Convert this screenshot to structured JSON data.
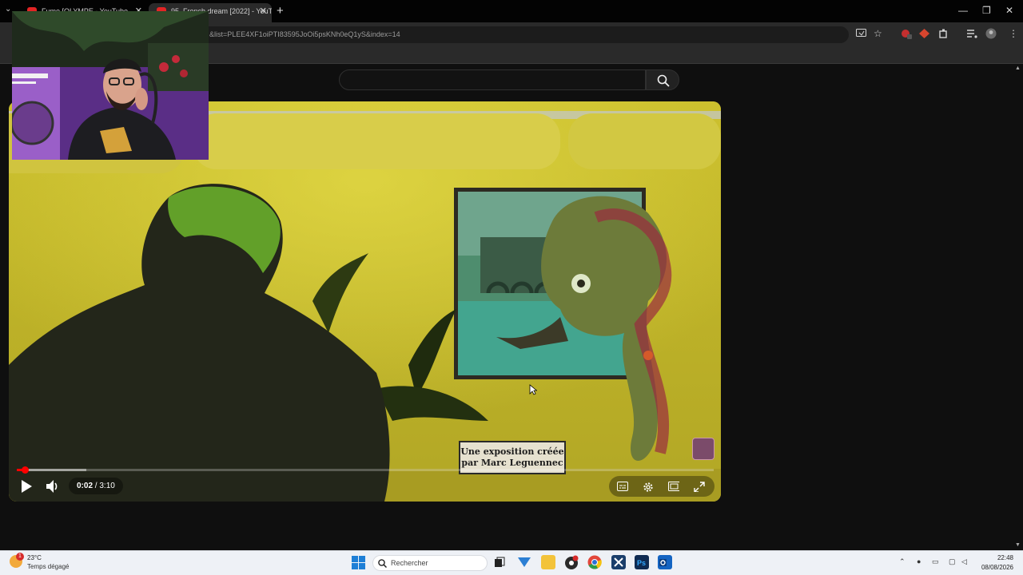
{
  "browser": {
    "tabs": [
      {
        "title": "Fume [OLYMPE - YouTube",
        "active": false
      },
      {
        "title": "95. French dream [2022] - YouT",
        "active": true
      }
    ],
    "tab_close_glyph": "✕",
    "new_tab_glyph": "+",
    "tab_search_glyph": "⌄",
    "window_controls": {
      "minimize": "—",
      "restore": "❐",
      "close": "✕"
    },
    "address_url": "&list=PLEE4XF1oiPTI83595JoOi5psKNh0eQ1yS&index=14",
    "toolbar_icons": [
      "cast-icon",
      "star-icon",
      "extension-icon",
      "puzzle-icon",
      "media-icon",
      "profile-icon",
      "menu-icon"
    ],
    "menu_glyph": "⋮",
    "star_glyph": "☆"
  },
  "youtube": {
    "search_placeholder": "",
    "video": {
      "caption_line1": "Une exposition créée",
      "caption_line2": "par Marc Leguennec",
      "time_current": "0:02",
      "time_separator": " / ",
      "time_total": "3:10",
      "progress_played_fraction": 0.011,
      "progress_buffered_fraction": 0.1
    }
  },
  "taskbar": {
    "weather_temp": "23°C",
    "weather_desc": "Temps dégagé",
    "weather_badge": "1",
    "search_label": "Rechercher",
    "time": "22:48",
    "date": "08/08/2026",
    "apps": [
      "task-view-icon",
      "vscode-icon",
      "file-explorer-icon",
      "obs-icon",
      "chrome-icon",
      "cursor-app-icon",
      "photoshop-icon",
      "outlook-icon"
    ],
    "app_colors": {
      "vscode": "#2b7fd4",
      "explorer": "#f3c33a",
      "obs": "#2a2a2a",
      "chrome": "#e2463a",
      "photoshop": "#0f2b52",
      "outlook": "#1464c2"
    },
    "tray_glyphs": {
      "chevron": "⌃",
      "mic": "●",
      "keyboard": "▭",
      "display": "▢",
      "wifi": "◠",
      "volume": "◁",
      "battery": "▮"
    }
  }
}
